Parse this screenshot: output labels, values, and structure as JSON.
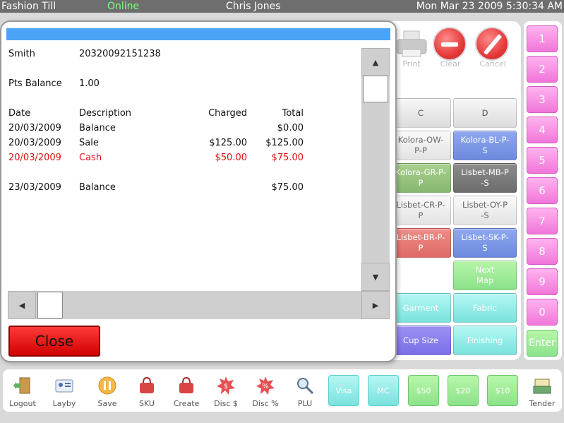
{
  "topbar": {
    "app": "Fashion Till",
    "status": "Online",
    "user": "Chris Jones",
    "datetime": "Mon Mar 23 2009 5:30:34 AM"
  },
  "actions": {
    "print": "Print",
    "clear": "Clear",
    "cancel": "Cancel"
  },
  "grid": {
    "col_c": "C",
    "col_d": "D",
    "items": [
      "Kolora-OW-\nP-P",
      "Kolora-BL-P-\nS",
      "Kolora-GR-P-\nP",
      "Lisbet-MB-P\n-S",
      "Lisbet-CR-P-\nP",
      "Lisbet-OY-P\n-S",
      "Lisbet-BR-P-\nP",
      "Lisbet-SK-P-\nS"
    ],
    "next_map": "Next\nMap",
    "garment": "Garment",
    "fabric": "Fabric",
    "cup_size": "Cup Size",
    "finishing": "Finishing"
  },
  "numpad": {
    "keys": [
      "1",
      "2",
      "3",
      "4",
      "5",
      "6",
      "7",
      "8",
      "9",
      "0"
    ],
    "enter": "Enter"
  },
  "dialog": {
    "customer_name": "Smith",
    "customer_id": "20320092151238",
    "pts_label": "Pts Balance",
    "pts_value": "1.00",
    "headers": {
      "date": "Date",
      "description": "Description",
      "charged": "Charged",
      "total": "Total"
    },
    "rows": [
      {
        "date": "20/03/2009",
        "description": "Balance",
        "charged": "",
        "total": "$0.00"
      },
      {
        "date": "20/03/2009",
        "description": "Sale",
        "charged": "$125.00",
        "total": "$125.00"
      },
      {
        "date": "20/03/2009",
        "description": "Cash",
        "charged": "$50.00",
        "total": "$75.00"
      },
      {
        "date": "23/03/2009",
        "description": "Balance",
        "charged": "",
        "total": "$75.00"
      }
    ],
    "close_label": "Close"
  },
  "toolbar": {
    "logout": "Logout",
    "layby": "Layby",
    "save": "Save",
    "sku": "SKU",
    "create": "Create",
    "disc_dollar": "Disc $",
    "disc_pct": "Disc %",
    "plu": "PLU",
    "visa": "Visa",
    "mc": "MC",
    "fifty": "$50",
    "twenty": "$20",
    "ten": "$10",
    "tender": "Tender"
  },
  "colors": {
    "accent_blue": "#4aa3f7",
    "status_online": "#7dff7d",
    "close_red": "#e00000",
    "numpad_pink": "#f176d9",
    "cash_row_red": "#e01010"
  }
}
